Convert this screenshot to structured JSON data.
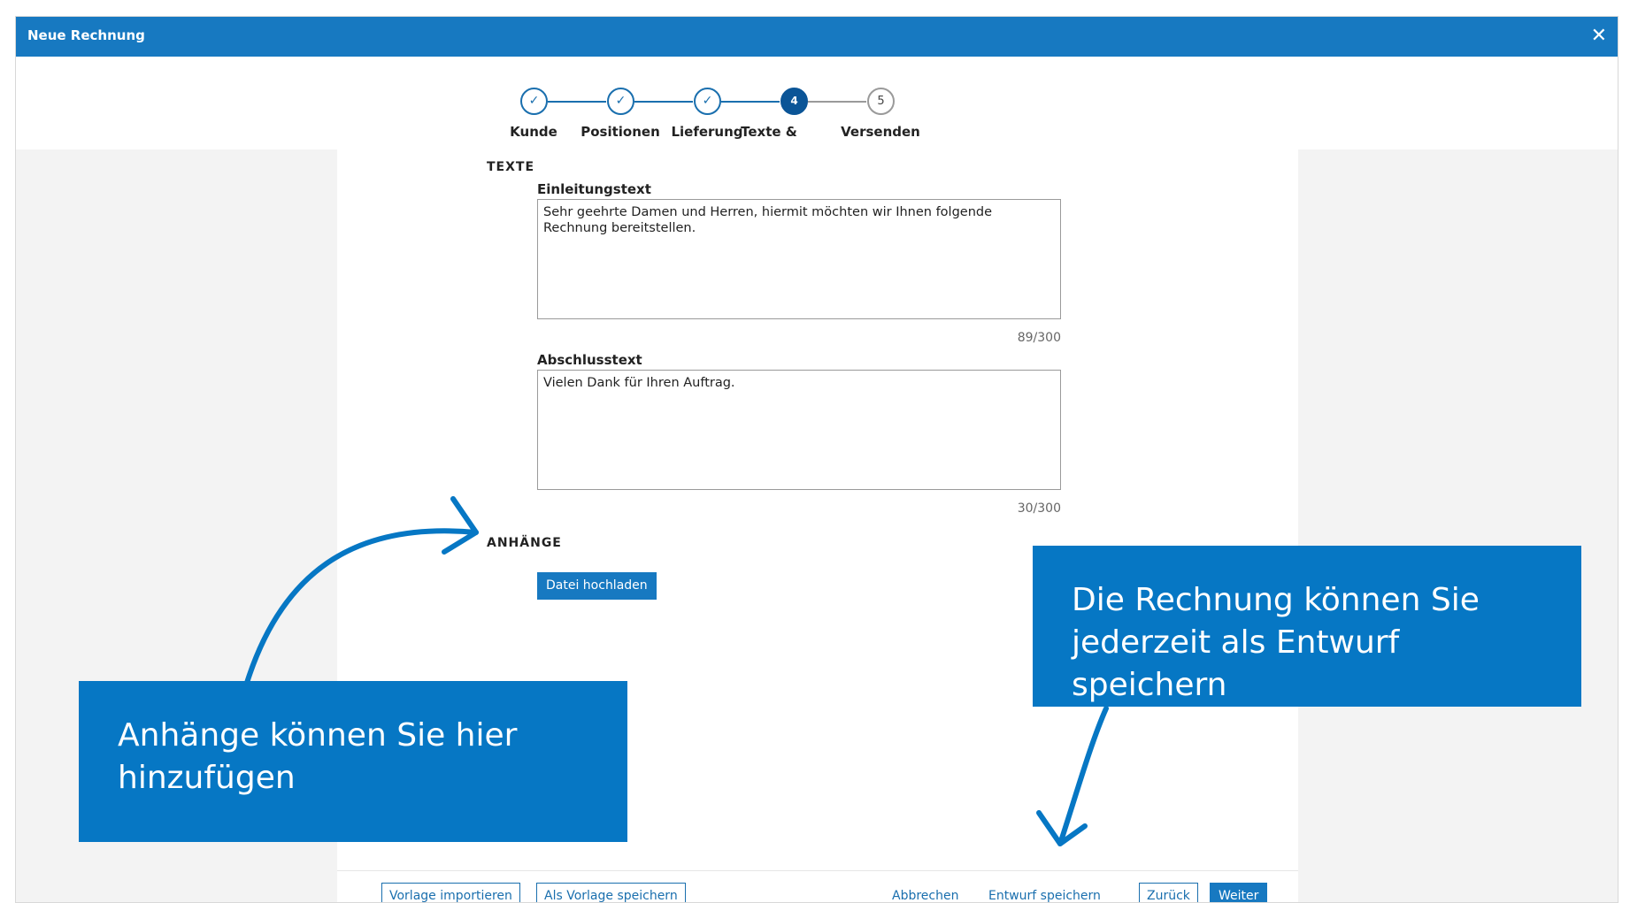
{
  "window": {
    "title": "Neue Rechnung",
    "close_glyph": "✕"
  },
  "steps": [
    {
      "label": "Kunde",
      "state": "done",
      "glyph": "✓"
    },
    {
      "label": "Positionen",
      "state": "done",
      "glyph": "✓"
    },
    {
      "label": "Lieferung",
      "state": "done",
      "glyph": "✓"
    },
    {
      "label": "Texte &",
      "state": "active",
      "glyph": "4"
    },
    {
      "label": "Versenden",
      "state": "todo",
      "glyph": "5"
    }
  ],
  "texte": {
    "heading": "TEXTE",
    "intro": {
      "label": "Einleitungstext",
      "value": "Sehr geehrte Damen und Herren, hiermit möchten wir Ihnen folgende Rechnung bereitstellen.",
      "counter": "89/300"
    },
    "closing": {
      "label": "Abschlusstext",
      "value": "Vielen Dank für Ihren Auftrag.",
      "counter": "30/300"
    }
  },
  "attachments": {
    "heading": "ANHÄNGE",
    "upload_label": "Datei hochladen"
  },
  "footer": {
    "import_template": "Vorlage importieren",
    "save_template": "Als Vorlage speichern",
    "cancel": "Abbrechen",
    "save_draft": "Entwurf speichern",
    "back": "Zurück",
    "next": "Weiter"
  },
  "callouts": {
    "attachments": "Anhänge können Sie hier hinzufügen",
    "draft": "Die Rechnung können Sie jederzeit als Entwurf speichern"
  },
  "colors": {
    "primary": "#1779c1",
    "callout": "#0677c4",
    "active_step": "#0b5597"
  }
}
